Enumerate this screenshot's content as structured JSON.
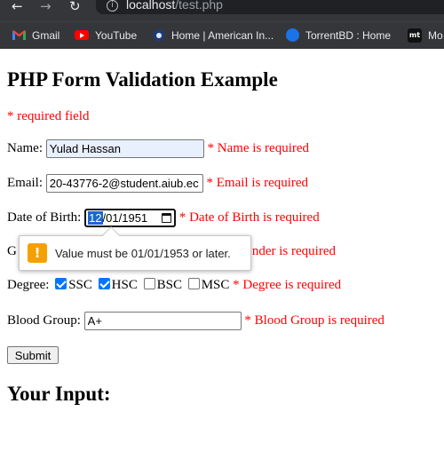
{
  "browser": {
    "url_host": "localhost",
    "url_path": "/test.php",
    "bookmarks": [
      {
        "label": "Gmail",
        "icon": "gmail-icon"
      },
      {
        "label": "YouTube",
        "icon": "youtube-icon"
      },
      {
        "label": "Home | American In...",
        "icon": "aiub-icon"
      },
      {
        "label": "TorrentBD : Home",
        "icon": "torrentbd-icon"
      },
      {
        "label": "Mo",
        "icon": "mt-icon"
      }
    ],
    "mt_icon_text": "mt"
  },
  "page": {
    "title": "PHP Form Validation Example",
    "required_note": "* required field",
    "name": {
      "label": "Name:",
      "value": "Yulad Hassan",
      "error": "* Name is required"
    },
    "email": {
      "label": "Email:",
      "value": "20-43776-2@student.aiub.ec",
      "error": "* Email is required"
    },
    "dob": {
      "label": "Date of Birth:",
      "month": "12",
      "rest": "/01/1951",
      "error": "* Date of Birth is required"
    },
    "gender": {
      "label_prefix": "G",
      "error_suffix": "nder is required"
    },
    "degree": {
      "label": "Degree:",
      "options": [
        {
          "label": "SSC",
          "checked": true
        },
        {
          "label": "HSC",
          "checked": true
        },
        {
          "label": "BSC",
          "checked": false
        },
        {
          "label": "MSC",
          "checked": false
        }
      ],
      "error": "* Degree is required"
    },
    "blood": {
      "label": "Blood Group:",
      "value": "A+",
      "error": "* Blood Group is required"
    },
    "submit_label": "Submit",
    "your_input_heading": "Your Input:"
  },
  "validation_bubble": {
    "icon": "!",
    "message": "Value must be 01/01/1953 or later."
  },
  "colors": {
    "error": "#ff0000",
    "chrome": "#35363a",
    "checkbox_accent": "#0075ff",
    "warning": "#f4a100"
  }
}
